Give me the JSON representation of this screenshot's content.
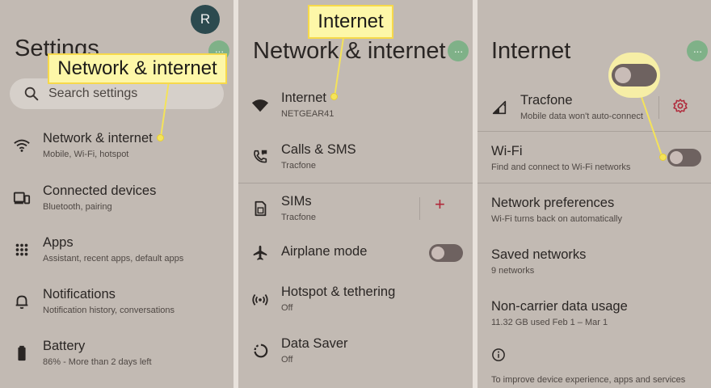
{
  "panel1": {
    "avatar_letter": "R",
    "more_label": "···",
    "title": "Settings",
    "search_placeholder": "Search settings",
    "items": [
      {
        "title": "Network & internet",
        "subtitle": "Mobile, Wi-Fi, hotspot",
        "icon": "wifi-icon"
      },
      {
        "title": "Connected devices",
        "subtitle": "Bluetooth, pairing",
        "icon": "devices-icon"
      },
      {
        "title": "Apps",
        "subtitle": "Assistant, recent apps, default apps",
        "icon": "apps-grid-icon"
      },
      {
        "title": "Notifications",
        "subtitle": "Notification history, conversations",
        "icon": "bell-icon"
      },
      {
        "title": "Battery",
        "subtitle": "86% - More than 2 days left",
        "icon": "battery-icon"
      }
    ],
    "callout": "Network & internet"
  },
  "panel2": {
    "more_label": "···",
    "title": "Network & internet",
    "items": [
      {
        "title": "Internet",
        "subtitle": "NETGEAR41",
        "icon": "wifi-filled-icon"
      },
      {
        "title": "Calls & SMS",
        "subtitle": "Tracfone",
        "icon": "phone-icon"
      },
      {
        "title": "SIMs",
        "subtitle": "Tracfone",
        "icon": "sim-card-icon"
      },
      {
        "title": "Airplane mode",
        "subtitle": "",
        "icon": "airplane-icon"
      },
      {
        "title": "Hotspot & tethering",
        "subtitle": "Off",
        "icon": "hotspot-icon"
      },
      {
        "title": "Data Saver",
        "subtitle": "Off",
        "icon": "data-saver-icon"
      }
    ],
    "add_label": "+",
    "callout": "Internet"
  },
  "panel3": {
    "more_label": "···",
    "title": "Internet",
    "carrier": {
      "title": "Tracfone",
      "subtitle": "Mobile data won't auto-connect",
      "icon": "signal-icon"
    },
    "wifi": {
      "title": "Wi-Fi",
      "subtitle": "Find and connect to Wi-Fi networks"
    },
    "items": [
      {
        "title": "Network preferences",
        "subtitle": "Wi-Fi turns back on automatically"
      },
      {
        "title": "Saved networks",
        "subtitle": "9 networks"
      },
      {
        "title": "Non-carrier data usage",
        "subtitle": "11.32 GB used Feb 1 – Mar 1"
      }
    ],
    "footer": "To improve device experience, apps and services"
  },
  "colors": {
    "panel_bg": "#c2bab3",
    "callout_bg": "#fdf7a8",
    "callout_border": "#f7d94a",
    "accent_green": "#7fb188",
    "toggle_off": "#6e6260",
    "add_red": "#b0293a"
  }
}
